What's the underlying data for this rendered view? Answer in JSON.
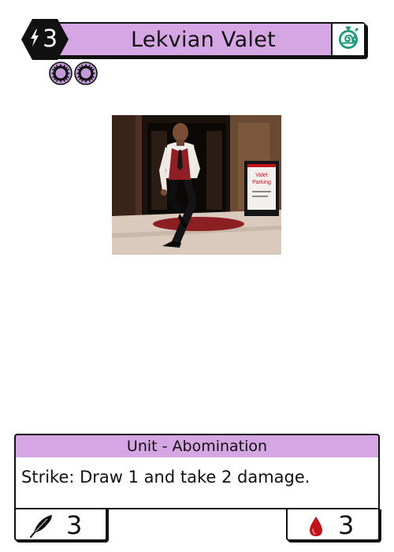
{
  "card": {
    "name": "Lekvian Valet",
    "cost": "3",
    "type_line": "Unit - Abomination",
    "rules_text": "Strike: Draw 1 and take 2 damage.",
    "power": "3",
    "health": "3",
    "element_icons": [
      "abomination-ring-icon",
      "abomination-ring-icon"
    ],
    "speed_icon": "snail-stopwatch-icon",
    "power_icon": "feather-quill-icon",
    "health_icon": "blood-drop-icon"
  },
  "art": {
    "sign_line1": "Valet",
    "sign_line2": "Parking"
  },
  "colors": {
    "title_bar": "#d6a6e4",
    "type_bar": "#d6a6e4",
    "element_fill": "#c49bd8",
    "speed_icon": "#1f9a7a",
    "health_icon": "#c0131c",
    "cost_hex": "#111111"
  }
}
